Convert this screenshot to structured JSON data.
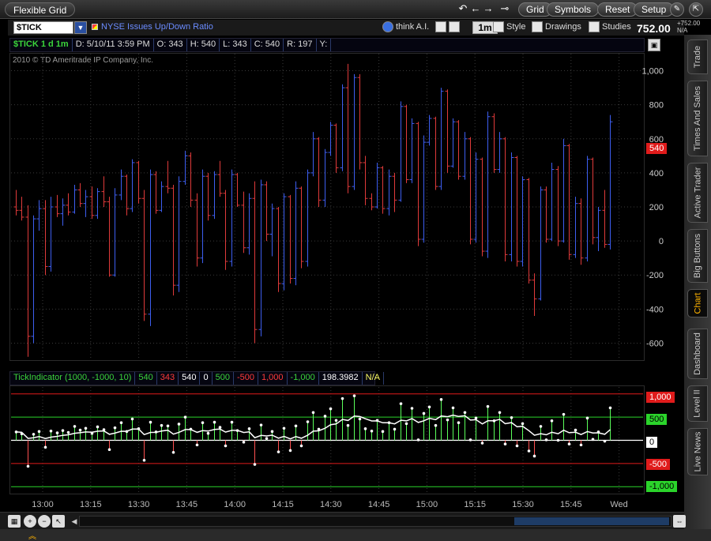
{
  "app": {
    "title": "Flexible Grid",
    "nav_buttons": [
      "undo-icon",
      "back-icon",
      "forward-icon",
      "link-icon"
    ],
    "buttons": {
      "grid": "Grid",
      "symbols": "Symbols",
      "reset": "Reset",
      "setup": "Setup"
    }
  },
  "toolbar": {
    "symbol": "$TICK",
    "study_name": "NYSE Issues Up/Down Ratio",
    "think": "think A.I.",
    "timeframe": "1m",
    "style": "Style",
    "drawings": "Drawings",
    "studies": "Studies",
    "last_price": "752.00",
    "change": "+752.00",
    "change_pct": "N/A"
  },
  "infobar": {
    "symbol_period": "$TICK 1 d 1m",
    "date": "D: 5/10/11 3:59 PM",
    "open": "O: 343",
    "high": "H: 540",
    "low": "L: 343",
    "close": "C: 540",
    "range": "R: 197",
    "y": "Y:"
  },
  "copyright": "2010 © TD Ameritrade IP Company, Inc.",
  "price_badge": "540",
  "indicator": {
    "name": "TickIndicator (1000, -1000, 10)",
    "values": [
      {
        "text": "540",
        "color": "#3bd43b"
      },
      {
        "text": "343",
        "color": "#ff3b3b"
      },
      {
        "text": "540",
        "color": "#ffffff"
      },
      {
        "text": "0",
        "color": "#ffffff"
      },
      {
        "text": "500",
        "color": "#3bd43b"
      },
      {
        "text": "-500",
        "color": "#ff3b3b"
      },
      {
        "text": "1,000",
        "color": "#ff3b3b"
      },
      {
        "text": "-1,000",
        "color": "#3bd43b"
      },
      {
        "text": "198.3982",
        "color": "#ffffff"
      },
      {
        "text": "N/A",
        "color": "#ffff66"
      }
    ],
    "level_badges": [
      "1,000",
      "500",
      "0",
      "-500",
      "-1,000"
    ]
  },
  "sidebar_tabs": [
    {
      "label": "Trade",
      "active": false
    },
    {
      "label": "Times And Sales",
      "active": false
    },
    {
      "label": "Active Trader",
      "active": false
    },
    {
      "label": "Big Buttons",
      "active": false
    },
    {
      "label": "Chart",
      "active": true
    },
    {
      "label": "Dashboard",
      "active": false
    },
    {
      "label": "Level II",
      "active": false
    },
    {
      "label": "Live News",
      "active": false
    }
  ],
  "chart_data": {
    "type": "bar",
    "colors": {
      "up": "#3d5ef0",
      "down": "#e03a3a",
      "background": "#000000",
      "grid": "#3a3a3a"
    },
    "price_axis": {
      "ticks": [
        1000,
        800,
        600,
        400,
        200,
        0,
        -200,
        -400,
        -600
      ],
      "ylim": [
        -700,
        1100
      ]
    },
    "time_axis": {
      "labels": [
        "13:00",
        "13:15",
        "13:30",
        "13:45",
        "14:00",
        "14:15",
        "14:30",
        "14:45",
        "15:00",
        "15:15",
        "15:30",
        "15:45",
        "Wed"
      ]
    },
    "indicator_levels": [
      1000,
      500,
      0,
      -500,
      -1000
    ],
    "ohlc": [
      [
        200,
        300,
        150,
        180
      ],
      [
        180,
        260,
        120,
        140
      ],
      [
        140,
        210,
        -680,
        -560
      ],
      [
        -560,
        150,
        -600,
        130
      ],
      [
        130,
        240,
        60,
        190
      ],
      [
        190,
        240,
        -200,
        -150
      ],
      [
        -150,
        260,
        -180,
        200
      ],
      [
        200,
        270,
        140,
        160
      ],
      [
        160,
        250,
        90,
        210
      ],
      [
        210,
        280,
        150,
        170
      ],
      [
        170,
        330,
        160,
        300
      ],
      [
        300,
        340,
        200,
        220
      ],
      [
        220,
        300,
        140,
        260
      ],
      [
        260,
        320,
        130,
        150
      ],
      [
        150,
        310,
        130,
        290
      ],
      [
        290,
        380,
        200,
        230
      ],
      [
        230,
        260,
        -210,
        -200
      ],
      [
        -200,
        310,
        -210,
        270
      ],
      [
        270,
        420,
        240,
        380
      ],
      [
        380,
        390,
        150,
        190
      ],
      [
        190,
        480,
        170,
        460
      ],
      [
        460,
        470,
        220,
        250
      ],
      [
        250,
        300,
        -470,
        -430
      ],
      [
        -430,
        420,
        -500,
        390
      ],
      [
        390,
        410,
        160,
        180
      ],
      [
        180,
        350,
        170,
        320
      ],
      [
        320,
        470,
        280,
        310
      ],
      [
        310,
        330,
        -320,
        -260
      ],
      [
        -260,
        380,
        -300,
        350
      ],
      [
        350,
        530,
        330,
        500
      ],
      [
        500,
        520,
        200,
        240
      ],
      [
        240,
        280,
        -150,
        -100
      ],
      [
        -100,
        420,
        -130,
        380
      ],
      [
        380,
        400,
        120,
        150
      ],
      [
        150,
        410,
        130,
        390
      ],
      [
        390,
        470,
        260,
        280
      ],
      [
        280,
        300,
        -170,
        -120
      ],
      [
        -120,
        420,
        -150,
        390
      ],
      [
        390,
        400,
        200,
        210
      ],
      [
        210,
        290,
        -70,
        -40
      ],
      [
        -40,
        280,
        -80,
        250
      ],
      [
        250,
        350,
        -600,
        -520
      ],
      [
        -520,
        360,
        -560,
        330
      ],
      [
        330,
        350,
        0,
        40
      ],
      [
        40,
        220,
        -90,
        190
      ],
      [
        190,
        200,
        -300,
        -250
      ],
      [
        -250,
        280,
        -290,
        260
      ],
      [
        260,
        270,
        -250,
        -220
      ],
      [
        -220,
        350,
        -260,
        310
      ],
      [
        310,
        320,
        -160,
        -120
      ],
      [
        -120,
        420,
        -150,
        400
      ],
      [
        400,
        640,
        380,
        600
      ],
      [
        600,
        610,
        200,
        240
      ],
      [
        240,
        540,
        200,
        520
      ],
      [
        520,
        700,
        500,
        680
      ],
      [
        680,
        690,
        400,
        430
      ],
      [
        430,
        920,
        410,
        900
      ],
      [
        900,
        1040,
        280,
        320
      ],
      [
        320,
        980,
        300,
        960
      ],
      [
        960,
        980,
        420,
        460
      ],
      [
        460,
        500,
        210,
        250
      ],
      [
        250,
        280,
        180,
        200
      ],
      [
        200,
        460,
        190,
        430
      ],
      [
        430,
        440,
        160,
        190
      ],
      [
        190,
        420,
        150,
        380
      ],
      [
        380,
        400,
        170,
        240
      ],
      [
        240,
        820,
        230,
        790
      ],
      [
        790,
        800,
        340,
        360
      ],
      [
        360,
        720,
        340,
        690
      ],
      [
        690,
        700,
        -30,
        10
      ],
      [
        10,
        620,
        -10,
        580
      ],
      [
        580,
        740,
        560,
        720
      ],
      [
        720,
        730,
        300,
        320
      ],
      [
        320,
        900,
        300,
        880
      ],
      [
        880,
        890,
        400,
        440
      ],
      [
        440,
        720,
        430,
        700
      ],
      [
        700,
        710,
        360,
        380
      ],
      [
        380,
        640,
        360,
        600
      ],
      [
        600,
        610,
        -20,
        10
      ],
      [
        10,
        520,
        -10,
        480
      ],
      [
        480,
        490,
        -90,
        -60
      ],
      [
        -60,
        760,
        -100,
        730
      ],
      [
        730,
        750,
        400,
        420
      ],
      [
        420,
        640,
        400,
        600
      ],
      [
        600,
        610,
        -120,
        -80
      ],
      [
        -80,
        520,
        -120,
        490
      ],
      [
        490,
        500,
        -150,
        -120
      ],
      [
        -120,
        380,
        -150,
        360
      ],
      [
        360,
        370,
        -250,
        -230
      ],
      [
        -230,
        -190,
        -440,
        -340
      ],
      [
        -340,
        320,
        -350,
        300
      ],
      [
        300,
        320,
        -10,
        10
      ],
      [
        10,
        460,
        0,
        420
      ],
      [
        420,
        440,
        -30,
        0
      ],
      [
        0,
        600,
        -10,
        560
      ],
      [
        560,
        570,
        -110,
        -80
      ],
      [
        -80,
        260,
        -100,
        220
      ],
      [
        220,
        250,
        -140,
        -100
      ],
      [
        -100,
        500,
        -120,
        480
      ],
      [
        480,
        490,
        -20,
        20
      ],
      [
        20,
        200,
        -60,
        180
      ],
      [
        180,
        300,
        -40,
        -20
      ],
      [
        -20,
        740,
        -50,
        700
      ]
    ]
  }
}
